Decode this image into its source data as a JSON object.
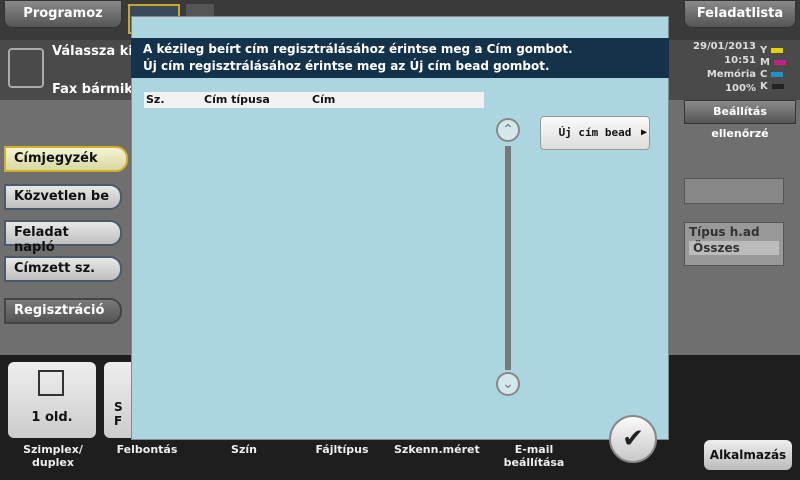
{
  "top": {
    "programs_label": "Programoz",
    "tasks_label": "Feladatlista"
  },
  "info": {
    "instruction_partial": "Válassza ki a",
    "fax_partial": "Fax bármiko",
    "date": "29/01/2013",
    "time": "10:51",
    "memory_label": "Memória",
    "memory_value": "100%",
    "toner": [
      {
        "letter": "Y",
        "color": "#e6d200"
      },
      {
        "letter": "M",
        "color": "#c0208a"
      },
      {
        "letter": "C",
        "color": "#1f8fd0"
      },
      {
        "letter": "K",
        "color": "#222222"
      }
    ]
  },
  "sidebar": {
    "items": [
      {
        "label": "Címjegyzék"
      },
      {
        "label": "Közvetlen be"
      },
      {
        "label": "Feladat napló"
      },
      {
        "label": "Címzett sz."
      },
      {
        "label": "Regisztráció"
      }
    ]
  },
  "right_panel": {
    "settings_check": "Beállítás ellenőrzé",
    "type_label": "Típus h.ad",
    "type_value": "Összes",
    "apply_label": "Alkalmazás"
  },
  "bottom": {
    "tile1_value": "1 old.",
    "tile2_value_partial": "S\nF",
    "labels": [
      "Szimplex/\nduplex",
      "Felbontás",
      "Szín",
      "Fájltípus",
      "Szkenn.méret",
      "E-mail\nbeállítása"
    ]
  },
  "dialog": {
    "message_line1": "A kézileg beírt cím regisztrálásához érintse meg a Cím gombot.",
    "message_line2": "Új cím regisztrálásához érintse meg az Új cím bead gombot.",
    "columns": [
      "Sz.",
      "Cím típusa",
      "Cím"
    ],
    "new_address_button": "Új cím bead",
    "ok_icon": "checkmark-icon"
  }
}
